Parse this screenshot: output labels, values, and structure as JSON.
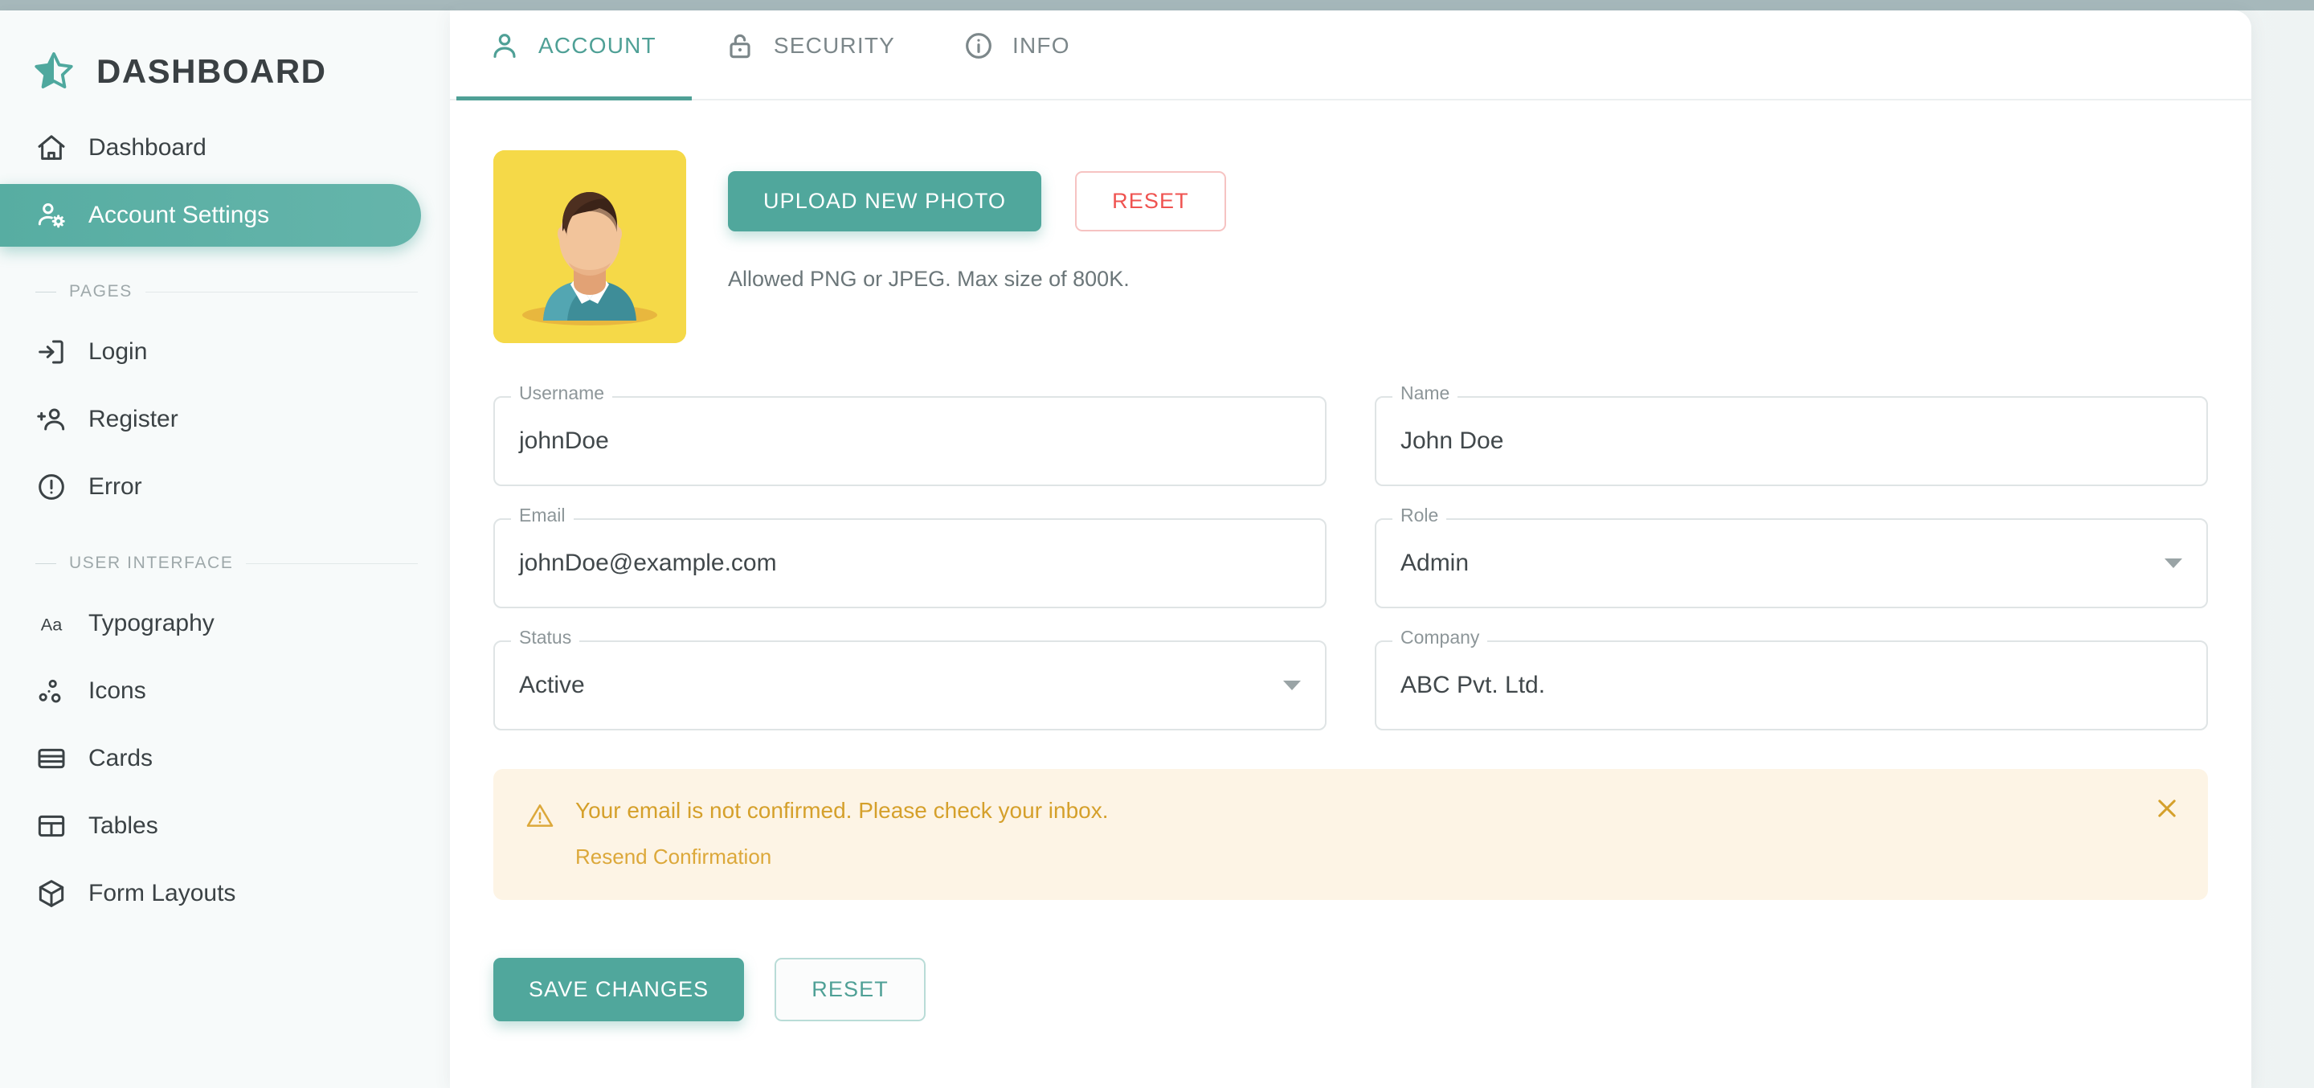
{
  "brand": {
    "title": "DASHBOARD",
    "logo_icon": "star-icon"
  },
  "colors": {
    "accent_teal": "#50a79c",
    "avatar_yellow": "#f5d948",
    "warning_amber": "#d5a02b",
    "danger_red": "#ef5350",
    "sidebar_bg": "#f7fafa"
  },
  "sidebar": {
    "items": [
      {
        "label": "Dashboard",
        "icon": "home-icon",
        "active": false
      },
      {
        "label": "Account Settings",
        "icon": "account-settings-icon",
        "active": true
      }
    ],
    "sections": [
      {
        "label": "PAGES",
        "items": [
          {
            "label": "Login",
            "icon": "login-icon"
          },
          {
            "label": "Register",
            "icon": "register-icon"
          },
          {
            "label": "Error",
            "icon": "error-icon"
          }
        ]
      },
      {
        "label": "USER INTERFACE",
        "items": [
          {
            "label": "Typography",
            "icon": "typography-icon"
          },
          {
            "label": "Icons",
            "icon": "icons-icon"
          },
          {
            "label": "Cards",
            "icon": "cards-icon"
          },
          {
            "label": "Tables",
            "icon": "tables-icon"
          },
          {
            "label": "Form Layouts",
            "icon": "form-layouts-icon"
          }
        ]
      }
    ]
  },
  "tabs": [
    {
      "label": "ACCOUNT",
      "icon": "person-icon",
      "active": true
    },
    {
      "label": "SECURITY",
      "icon": "lock-icon",
      "active": false
    },
    {
      "label": "INFO",
      "icon": "info-icon",
      "active": false
    }
  ],
  "avatar_section": {
    "avatar_alt": "user-avatar-illustration",
    "upload_label": "UPLOAD NEW PHOTO",
    "reset_label": "RESET",
    "hint": "Allowed PNG or JPEG. Max size of 800K."
  },
  "form": {
    "username": {
      "label": "Username",
      "value": "johnDoe",
      "type": "text"
    },
    "name": {
      "label": "Name",
      "value": "John Doe",
      "type": "text"
    },
    "email": {
      "label": "Email",
      "value": "johnDoe@example.com",
      "type": "text"
    },
    "role": {
      "label": "Role",
      "value": "Admin",
      "type": "select"
    },
    "status": {
      "label": "Status",
      "value": "Active",
      "type": "select"
    },
    "company": {
      "label": "Company",
      "value": "ABC Pvt. Ltd.",
      "type": "text"
    }
  },
  "alert": {
    "icon": "warning-triangle-icon",
    "message": "Your email is not confirmed. Please check your inbox.",
    "link_label": "Resend Confirmation",
    "close_icon": "close-icon"
  },
  "footer": {
    "save_label": "SAVE CHANGES",
    "reset_label": "RESET"
  }
}
